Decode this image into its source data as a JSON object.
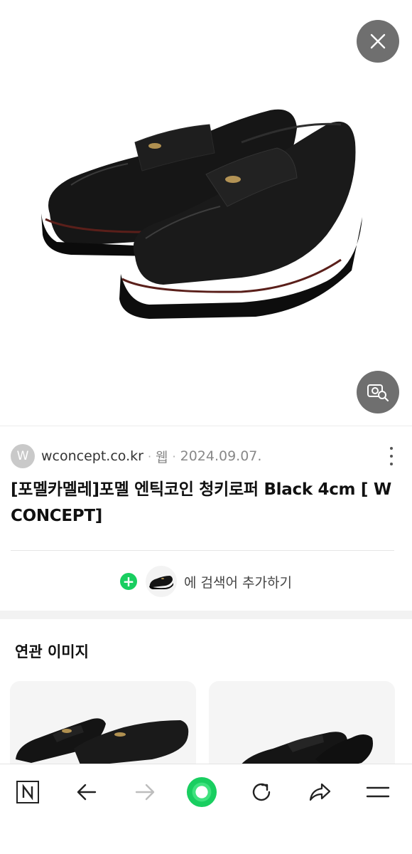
{
  "viewer": {
    "close_icon": "close-icon",
    "lens_icon": "image-search-icon"
  },
  "result": {
    "favicon_letter": "W",
    "domain": "wconcept.co.kr",
    "separator": "·",
    "type": "웹",
    "date": "2024.09.07.",
    "title": "[포멜카멜레]포멜 엔틱코인 청키로퍼 Black 4cm [ W CONCEPT]"
  },
  "add_search": {
    "label": "에 검색어 추가하기",
    "plus_symbol": "+"
  },
  "related": {
    "title": "연관 이미지"
  },
  "bottom_nav": {
    "items": [
      "naver-home-icon",
      "back-arrow-icon",
      "forward-arrow-icon",
      "green-dot-icon",
      "refresh-icon",
      "share-icon",
      "menu-icon"
    ]
  },
  "colors": {
    "accent_green": "#19ce60",
    "overlay_button": "#6f6f6f"
  }
}
